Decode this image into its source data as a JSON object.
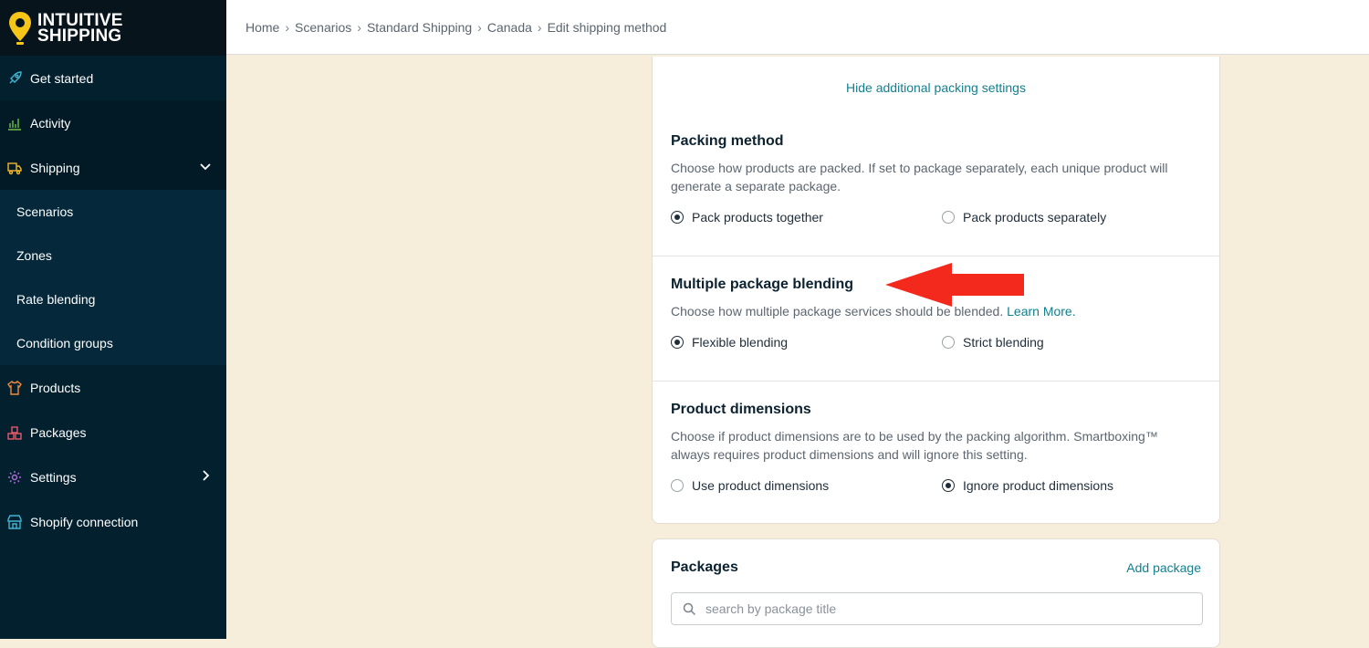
{
  "brand": {
    "line1": "INTUITIVE",
    "line2": "SHIPPING",
    "accent": "#f5c518"
  },
  "sidebar": {
    "items": [
      {
        "label": "Get started",
        "icon": "rocket-icon"
      },
      {
        "label": "Activity",
        "icon": "chart-icon"
      },
      {
        "label": "Shipping",
        "icon": "truck-icon"
      },
      {
        "label": "Products",
        "icon": "shirt-icon"
      },
      {
        "label": "Packages",
        "icon": "boxes-icon"
      },
      {
        "label": "Settings",
        "icon": "gear-icon"
      },
      {
        "label": "Shopify connection",
        "icon": "store-icon"
      }
    ],
    "shipping_sub": [
      "Scenarios",
      "Zones",
      "Rate blending",
      "Condition groups"
    ]
  },
  "breadcrumb": [
    "Home",
    "Scenarios",
    "Standard Shipping",
    "Canada",
    "Edit shipping method"
  ],
  "packing": {
    "hide_link": "Hide additional packing settings",
    "method": {
      "title": "Packing method",
      "desc": "Choose how products are packed. If set to package separately, each unique product will generate a separate package.",
      "options": [
        "Pack products together",
        "Pack products separately"
      ],
      "selected": 0
    },
    "blending": {
      "title": "Multiple package blending",
      "desc": "Choose how multiple package services should be blended.",
      "learn_more": "Learn More.",
      "options": [
        "Flexible blending",
        "Strict blending"
      ],
      "selected": 0
    },
    "dimensions": {
      "title": "Product dimensions",
      "desc": "Choose if product dimensions are to be used by the packing algorithm. Smartboxing™ always requires product dimensions and will ignore this setting.",
      "options": [
        "Use product dimensions",
        "Ignore product dimensions"
      ],
      "selected": 1
    }
  },
  "packages": {
    "title": "Packages",
    "add_label": "Add package",
    "search_placeholder": "search by package title"
  },
  "colors": {
    "annotation_arrow": "#f4291d",
    "link": "#11808f",
    "sidebar": "#03202f"
  }
}
